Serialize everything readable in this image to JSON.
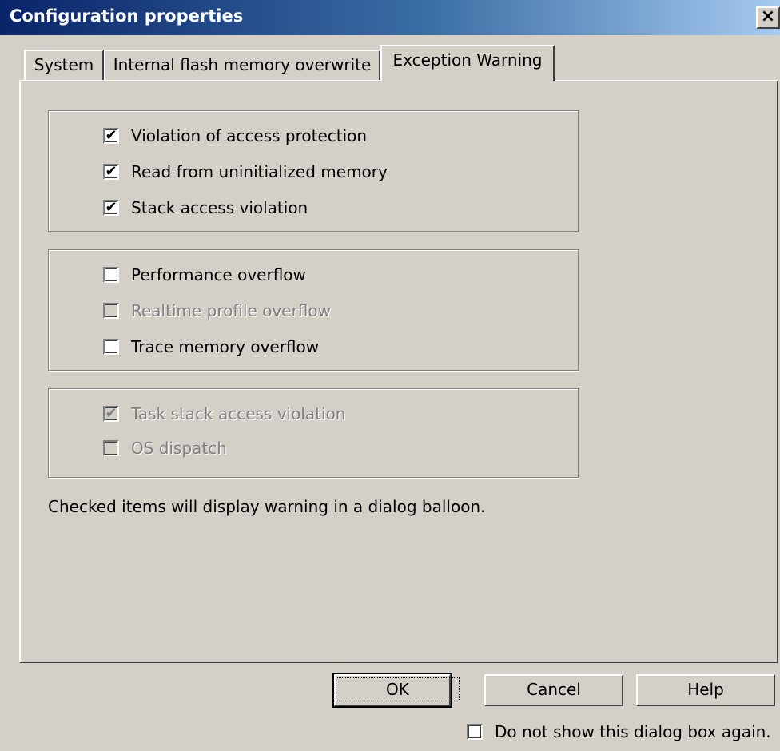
{
  "window": {
    "title": "Configuration properties",
    "close_glyph": "✕"
  },
  "tabs": [
    {
      "label": "System"
    },
    {
      "label": "Internal flash memory overwrite"
    },
    {
      "label": "Exception Warning"
    }
  ],
  "groups": {
    "access": [
      {
        "label": "Violation of access protection",
        "checked": true,
        "enabled": true
      },
      {
        "label": "Read from uninitialized memory",
        "checked": true,
        "enabled": true
      },
      {
        "label": "Stack access violation",
        "checked": true,
        "enabled": true
      }
    ],
    "overflow": [
      {
        "label": "Performance overflow",
        "checked": false,
        "enabled": true
      },
      {
        "label": "Realtime profile overflow",
        "checked": false,
        "enabled": false
      },
      {
        "label": "Trace memory overflow",
        "checked": false,
        "enabled": true
      }
    ],
    "os": [
      {
        "label": "Task stack access violation",
        "checked": true,
        "enabled": false
      },
      {
        "label": "OS dispatch",
        "checked": false,
        "enabled": false
      }
    ]
  },
  "note": "Checked items will display warning in a dialog balloon.",
  "buttons": {
    "ok": "OK",
    "cancel": "Cancel",
    "help": "Help"
  },
  "footer": {
    "dont_show_label": "Do not show this dialog box again.",
    "dont_show_checked": false
  },
  "icons": {
    "check": "✔"
  }
}
